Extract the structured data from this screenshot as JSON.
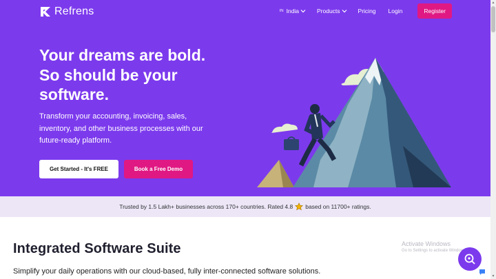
{
  "colors": {
    "hero_bg": "#7c3aed",
    "accent_pink": "#e01883",
    "trust_bg": "#ece6f7"
  },
  "nav": {
    "brand": "Refrens",
    "country_flag": "IN",
    "country": "India",
    "products": "Products",
    "pricing": "Pricing",
    "login": "Login",
    "register": "Register"
  },
  "hero": {
    "headline_line1": "Your dreams are bold.",
    "headline_line2": "So should be your",
    "headline_line3": "software.",
    "subtext": "Transform your accounting, invoicing, sales, inventory, and other business processes with our future-ready platform.",
    "cta_primary": "Get Started - It's FREE",
    "cta_secondary": "Book a Free Demo",
    "illustration": "man-climbing-mountain"
  },
  "trust": {
    "text_before": "Trusted by 1.5 Lakh+ businesses across 170+ countries. Rated 4.8",
    "icon": "star-icon",
    "text_after": "based on 11700+ ratings."
  },
  "section": {
    "title": "Integrated Software Suite",
    "subtitle": "Simplify your daily operations with our cloud-based, fully inter-connected software solutions."
  },
  "watermark": {
    "title": "Activate Windows",
    "subtitle": "Go to Settings to activate Windows."
  },
  "chat": {
    "icon": "search-chat-icon"
  }
}
